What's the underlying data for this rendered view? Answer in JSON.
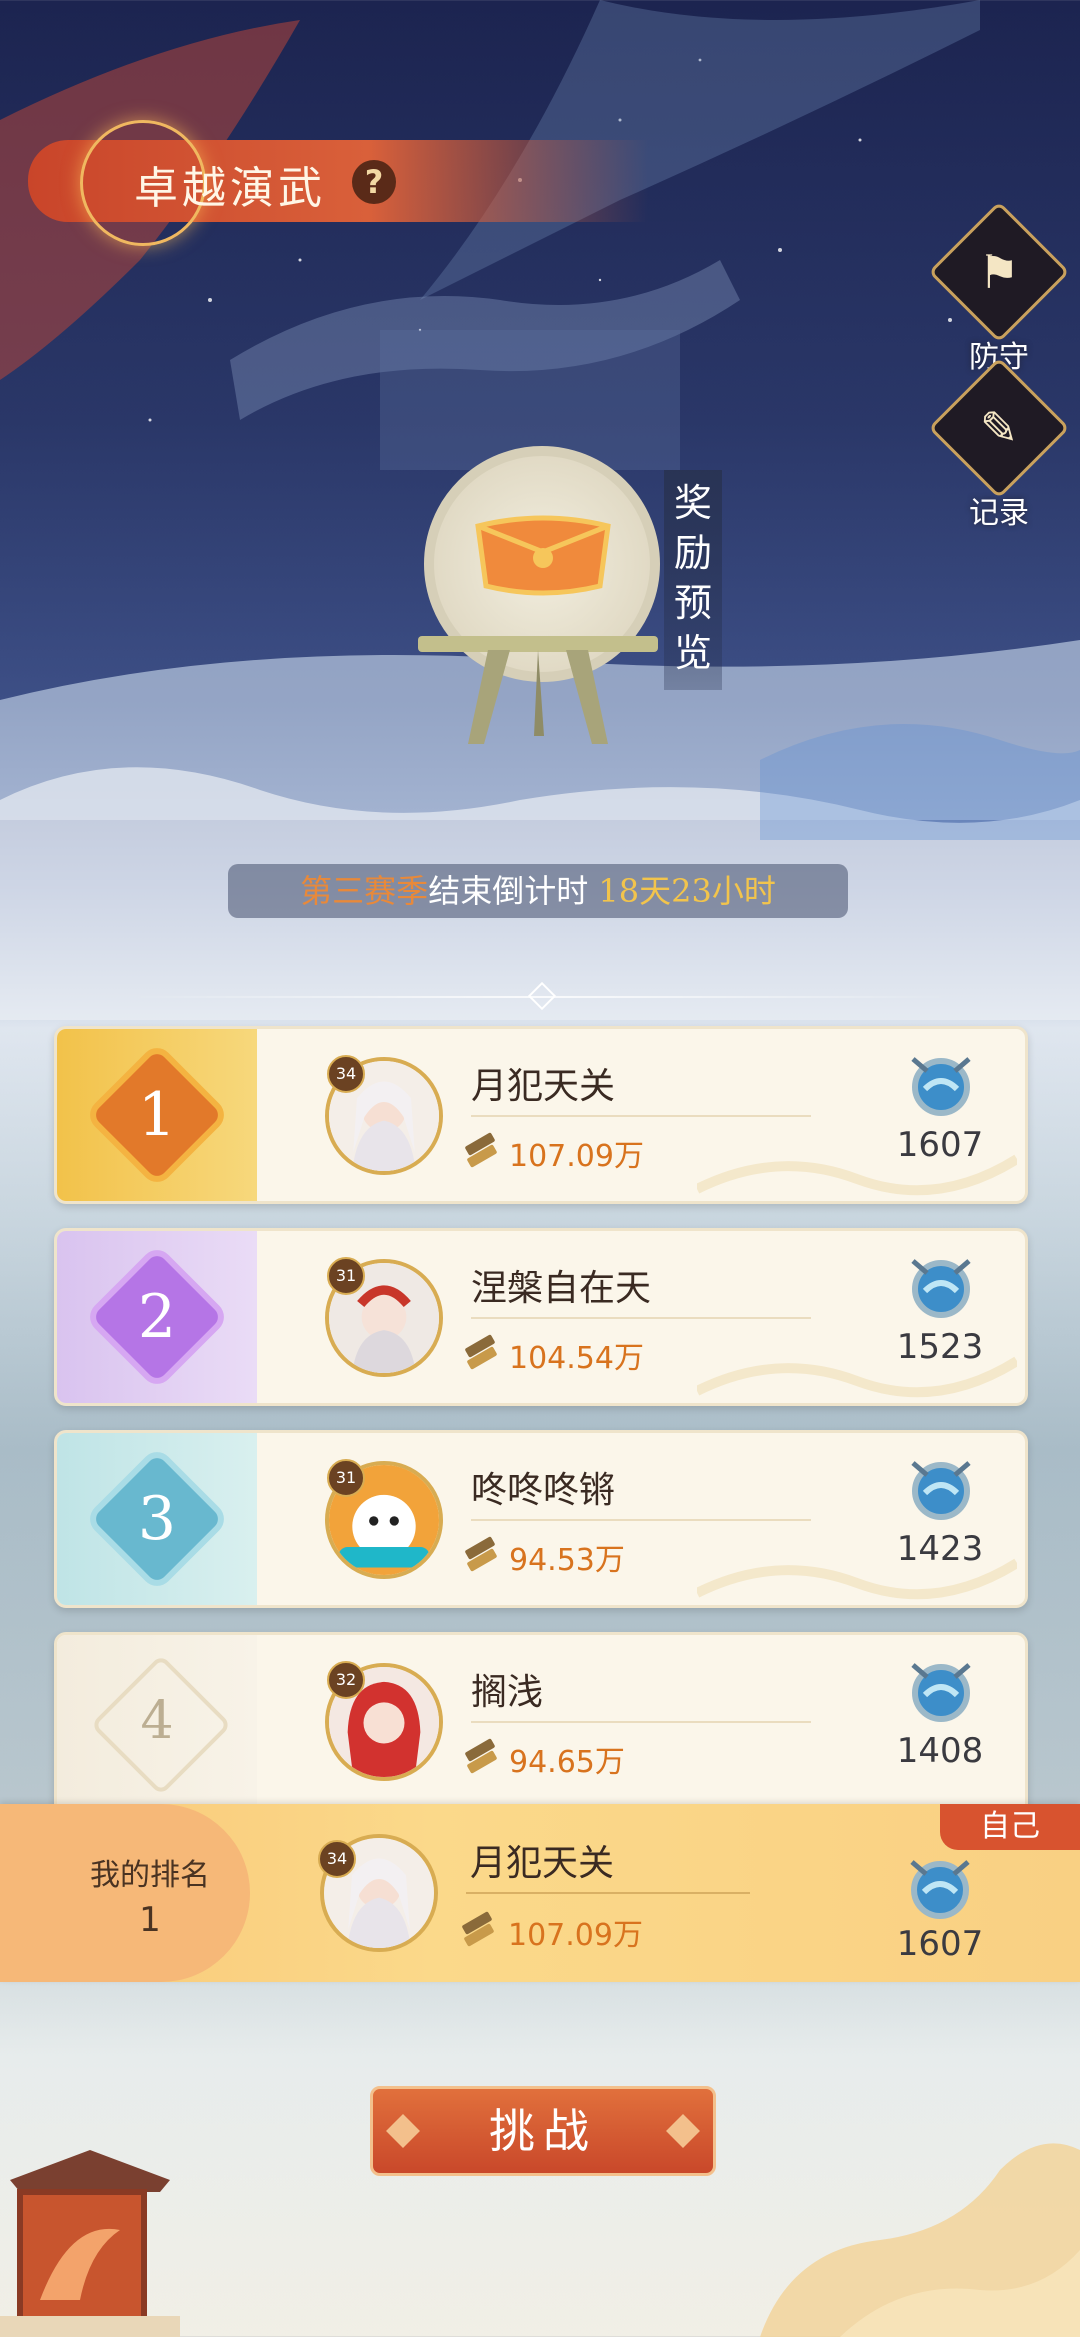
{
  "header": {
    "title": "卓越演武",
    "help_icon": "question-icon",
    "help_label": "?"
  },
  "side_buttons": [
    {
      "icon": "flag-icon",
      "label": "防守"
    },
    {
      "icon": "scroll-icon",
      "label": "记录"
    }
  ],
  "reward_preview": {
    "label": "奖励预览"
  },
  "countdown": {
    "season": "第三赛季",
    "text": "结束倒计时",
    "remaining": "18天23小时"
  },
  "ranking": [
    {
      "rank": "1",
      "level": "34",
      "name": "月犯天关",
      "power": "107.09万",
      "score": "1607"
    },
    {
      "rank": "2",
      "level": "31",
      "name": "涅槃自在天",
      "power": "104.54万",
      "score": "1523"
    },
    {
      "rank": "3",
      "level": "31",
      "name": "咚咚咚锵",
      "power": "94.53万",
      "score": "1423"
    },
    {
      "rank": "4",
      "level": "32",
      "name": "搁浅",
      "power": "94.65万",
      "score": "1408"
    }
  ],
  "my_rank": {
    "label": "我的排名",
    "rank": "1",
    "level": "34",
    "name": "月犯天关",
    "power": "107.09万",
    "score": "1607",
    "self_tag": "自己"
  },
  "challenge_button": {
    "label": "挑战"
  },
  "colors": {
    "rank1": "#f0a62e",
    "rank2": "#b07be0",
    "rank3": "#7fc6d6",
    "rank4": "#e6dcc6",
    "accent": "#d8731e"
  }
}
